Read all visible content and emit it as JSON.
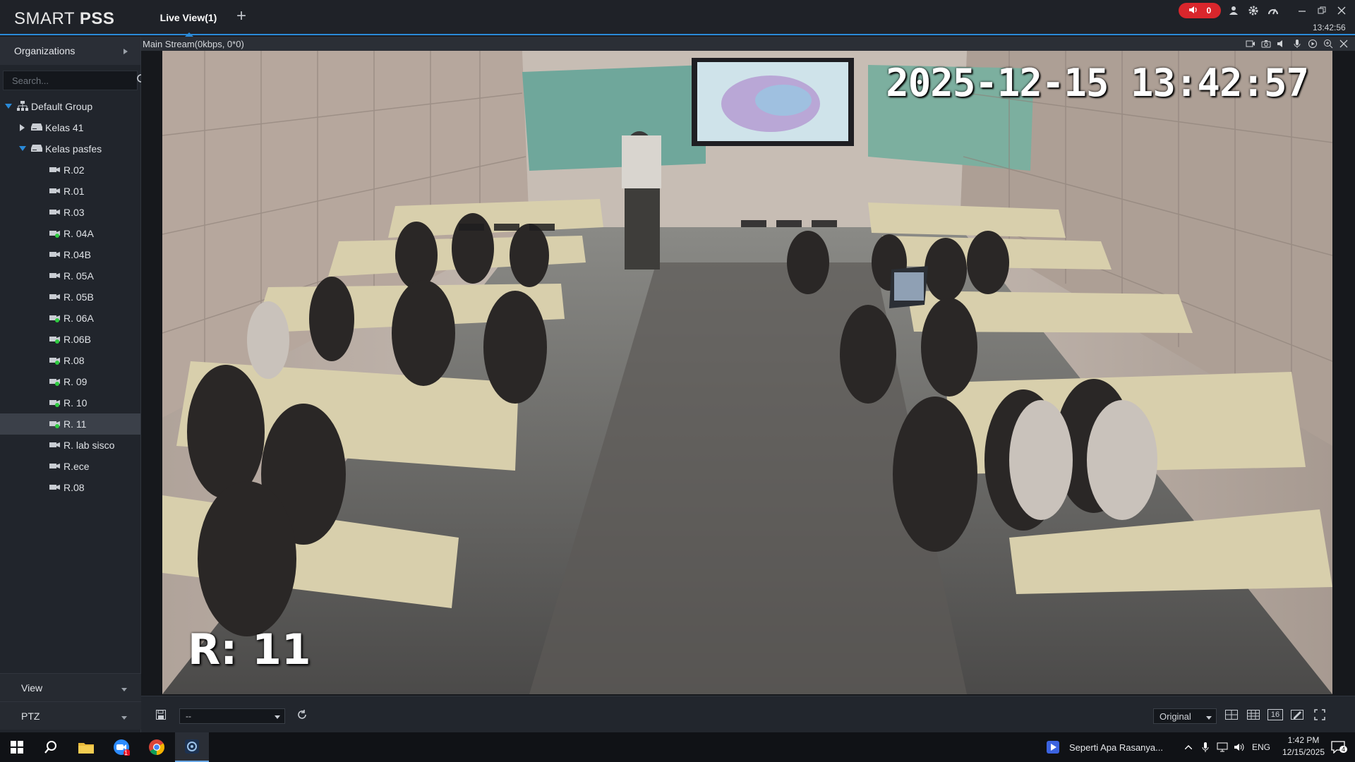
{
  "app": {
    "brand_light": "SMART ",
    "brand_bold": "PSS",
    "tab_label": "Live View(1)",
    "add_tab": "+",
    "alarm_count": "0",
    "clock": "13:42:56"
  },
  "sidebar": {
    "header": "Organizations",
    "search_placeholder": "Search...",
    "root": "Default Group",
    "groups": [
      {
        "label": "Kelas 41",
        "expanded": false
      },
      {
        "label": "Kelas pasfes",
        "expanded": true
      }
    ],
    "cameras": [
      {
        "label": "R.02",
        "online": false
      },
      {
        "label": "R.01",
        "online": false
      },
      {
        "label": "R.03",
        "online": false
      },
      {
        "label": "R. 04A",
        "online": true
      },
      {
        "label": "R.04B",
        "online": false
      },
      {
        "label": "R. 05A",
        "online": false
      },
      {
        "label": "R. 05B",
        "online": false
      },
      {
        "label": "R. 06A",
        "online": true
      },
      {
        "label": "R.06B",
        "online": true
      },
      {
        "label": "R.08",
        "online": true
      },
      {
        "label": "R. 09",
        "online": true
      },
      {
        "label": "R. 10",
        "online": true
      },
      {
        "label": "R. 11",
        "online": true,
        "selected": true
      },
      {
        "label": "R. lab sisco",
        "online": false
      },
      {
        "label": "R.ece",
        "online": false
      },
      {
        "label": "R.08",
        "online": false
      }
    ],
    "view_label": "View",
    "ptz_label": "PTZ"
  },
  "video": {
    "stream_info": "Main Stream(0kbps, 0*0)",
    "osd_timestamp": "2025-12-15  13:42:57",
    "osd_channel": "R: 11"
  },
  "bottom": {
    "preset_value": "--",
    "ratio_value": "Original",
    "grid_16": "16"
  },
  "taskbar": {
    "media_title": "Seperti Apa Rasanya...",
    "lang": "ENG",
    "time": "1:42 PM",
    "date": "12/15/2025",
    "notif_count": "4",
    "zoom_badge": "1"
  },
  "colors": {
    "accent": "#2a8ad8",
    "alarm": "#d9262c",
    "online": "#2ecc40"
  }
}
